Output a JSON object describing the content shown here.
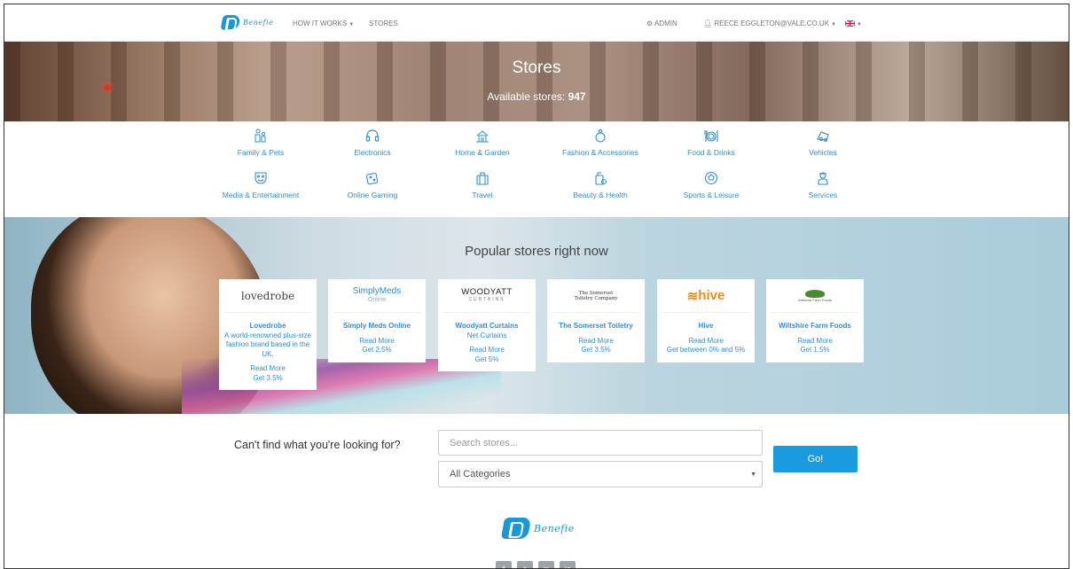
{
  "nav": {
    "logo_text": "Benefie",
    "how_it_works": "HOW IT WORKS",
    "stores": "STORES",
    "admin": "ADMIN",
    "user": "REECE EGGLETON@VALE.CO.UK",
    "language_icon": "uk-flag-icon"
  },
  "hero": {
    "title": "Stores",
    "subtitle_label": "Available stores:",
    "count": "947"
  },
  "categories": [
    {
      "label": "Family & Pets",
      "icon": "family-icon"
    },
    {
      "label": "Electronics",
      "icon": "headphones-icon"
    },
    {
      "label": "Home & Garden",
      "icon": "house-icon"
    },
    {
      "label": "Fashion & Accessories",
      "icon": "ring-icon"
    },
    {
      "label": "Food & Drinks",
      "icon": "dining-icon"
    },
    {
      "label": "Vehicles",
      "icon": "car-icon"
    },
    {
      "label": "Media & Entertainment",
      "icon": "masks-icon"
    },
    {
      "label": "Online Gaming",
      "icon": "dice-icon"
    },
    {
      "label": "Travel",
      "icon": "suitcase-icon"
    },
    {
      "label": "Beauty & Health",
      "icon": "bottle-icon"
    },
    {
      "label": "Sports & Leisure",
      "icon": "ball-icon"
    },
    {
      "label": "Services",
      "icon": "person-icon"
    }
  ],
  "popular": {
    "title": "Popular stores right now",
    "stores": [
      {
        "logo": "lovedrobe",
        "name": "Lovedrobe",
        "desc": "A world-renowned plus-size fashion brand based in the UK.",
        "read_more": "Read More",
        "cashback": "Get 3.5%"
      },
      {
        "logo": "SimplyMeds",
        "logo_sub": "Online",
        "name": "Simply Meds Online",
        "desc": "",
        "read_more": "Read More",
        "cashback": "Get 2.5%"
      },
      {
        "logo": "WOODYATT",
        "logo_sub": "CURTAINS",
        "name": "Woodyatt Curtains",
        "desc": "Net Curtains",
        "read_more": "Read More",
        "cashback": "Get 5%"
      },
      {
        "logo": "The Somerset Toiletry Company",
        "name": "The Somerset Toiletry",
        "desc": "",
        "read_more": "Read More",
        "cashback": "Get 3.5%"
      },
      {
        "logo": "hive",
        "name": "Hive",
        "desc": "",
        "read_more": "Read More",
        "cashback": "Get between 0% and 5%"
      },
      {
        "logo": "Wiltshire Farm Foods",
        "name": "Wiltshire Farm Foods",
        "desc": "",
        "read_more": "Read More",
        "cashback": "Get 1.5%"
      }
    ]
  },
  "search": {
    "label": "Can't find what you're looking for?",
    "placeholder": "Search stores...",
    "category_selected": "All Categories",
    "go": "Go!"
  },
  "footer": {
    "logo_text": "Benefie",
    "socials": [
      "f",
      "t",
      "in",
      "ig"
    ]
  },
  "colors": {
    "accent": "#1a9be0",
    "link": "#2f8fd0"
  }
}
